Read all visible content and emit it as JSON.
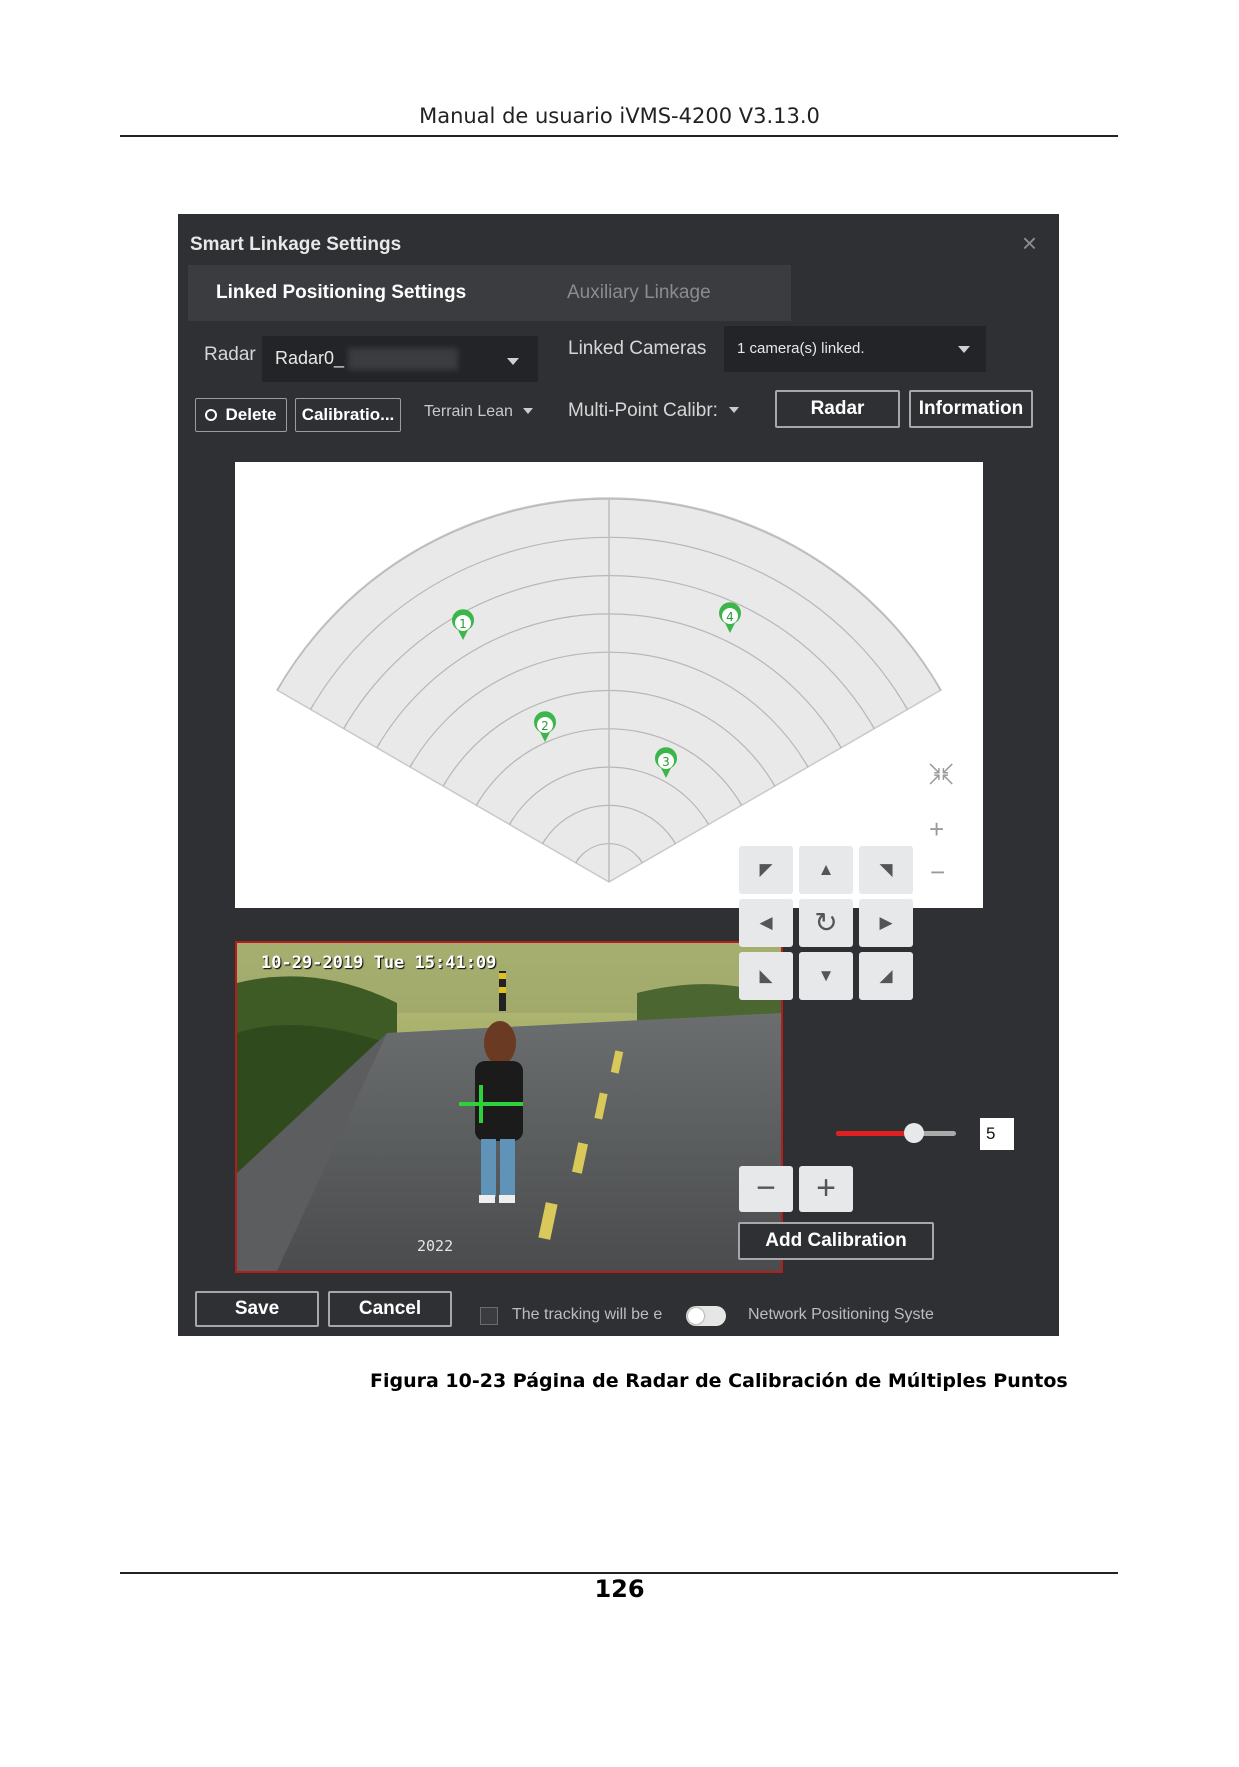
{
  "document": {
    "header": "Manual de usuario iVMS-4200 V3.13.0",
    "caption": "Figura 10-23 Página de Radar de Calibración de Múltiples Puntos",
    "page_number": "126"
  },
  "dialog": {
    "title": "Smart Linkage Settings",
    "close": "×",
    "tabs": {
      "active": "Linked Positioning Settings",
      "inactive": "Auxiliary Linkage"
    },
    "radar_label": "Radar",
    "radar_value": "Radar0_",
    "linked_cameras_label": "Linked Cameras",
    "linked_cameras_value": "1 camera(s) linked.",
    "toolbar": {
      "delete": "Delete",
      "calibration": "Calibratio...",
      "terrain": "Terrain Lean",
      "multipoint": "Multi-Point Calibr:",
      "radar": "Radar",
      "information": "Information"
    },
    "calibration_points": [
      "1",
      "2",
      "3",
      "4"
    ],
    "map_controls": {
      "fit": "fit-icon",
      "zoom_in": "+",
      "zoom_out": "−"
    },
    "video": {
      "osd": "10-29-2019 Tue 15:41:09",
      "tag": "2022"
    },
    "ptz": {
      "speed": "5",
      "speed_level": 0.65,
      "zoom_out": "−",
      "zoom_in": "+",
      "add_calibration": "Add Calibration"
    },
    "footer": {
      "save": "Save",
      "cancel": "Cancel",
      "tracking_text": "The tracking will be e",
      "network_text": "Network Positioning Syste"
    }
  }
}
